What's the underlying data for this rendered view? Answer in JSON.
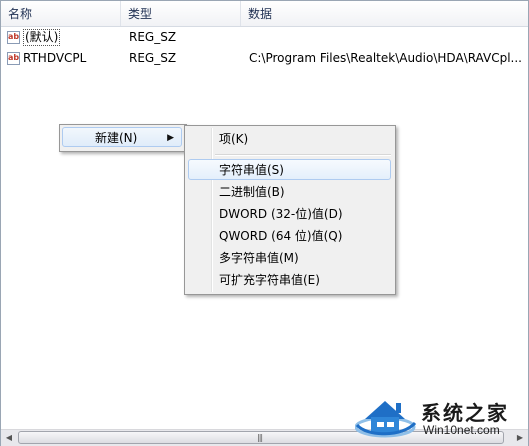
{
  "columns": {
    "name": "名称",
    "type": "类型",
    "data": "数据"
  },
  "rows": [
    {
      "icon": "ab",
      "name": "(默认)",
      "type": "REG_SZ",
      "data": ""
    },
    {
      "icon": "ab",
      "name": "RTHDVCPL",
      "type": "REG_SZ",
      "data": "C:\\Program Files\\Realtek\\Audio\\HDA\\RAVCpl..."
    }
  ],
  "context_menu": {
    "item": "新建(N)",
    "arrow": "▶"
  },
  "submenu": {
    "items": [
      "项(K)",
      "字符串值(S)",
      "二进制值(B)",
      "DWORD (32-位)值(D)",
      "QWORD (64 位)值(Q)",
      "多字符串值(M)",
      "可扩充字符串值(E)"
    ],
    "highlighted": "字符串值(S)"
  },
  "scrollbar": {
    "grip": "|||"
  },
  "watermark": {
    "title": "系统之家",
    "url": "Win10net.com"
  },
  "colors": {
    "accent": "#aecbf0",
    "icon_text": "#c0392b",
    "watermark_blue": "#1f6fc6"
  }
}
